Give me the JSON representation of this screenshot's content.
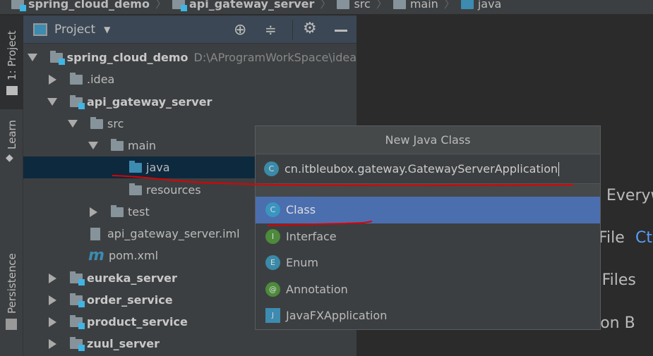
{
  "breadcrumb": [
    "spring_cloud_demo",
    "api_gateway_server",
    "src",
    "main",
    "java"
  ],
  "strip": {
    "project": "1: Project",
    "learn": "Learn",
    "persistence": "Persistence"
  },
  "panel": {
    "title": "Project"
  },
  "tree": [
    {
      "label": "spring_cloud_demo",
      "path": "D:\\AProgramWorkSpace\\idea"
    },
    {
      "label": ".idea"
    },
    {
      "label": "api_gateway_server"
    },
    {
      "label": "src"
    },
    {
      "label": "main"
    },
    {
      "label": "java"
    },
    {
      "label": "resources"
    },
    {
      "label": "test"
    },
    {
      "label": "api_gateway_server.iml"
    },
    {
      "label": "pom.xml"
    },
    {
      "label": "eureka_server"
    },
    {
      "label": "order_service"
    },
    {
      "label": "product_service"
    },
    {
      "label": "zuul_server"
    }
  ],
  "editor_hints": {
    "h1": "Everyw",
    "h2a": "File",
    "h2b": "Ct",
    "h3": "t Files",
    "h4": "ation B"
  },
  "dialog": {
    "title": "New Java Class",
    "value": "cn.itbleubox.gateway.GatewayServerApplication",
    "kinds": [
      {
        "label": "Class",
        "badge": "C",
        "color": "#3a95c0"
      },
      {
        "label": "Interface",
        "badge": "I",
        "color": "#4d8a3c"
      },
      {
        "label": "Enum",
        "badge": "E",
        "color": "#3a8aa8"
      },
      {
        "label": "Annotation",
        "badge": "@",
        "color": "#4d8a3c"
      },
      {
        "label": "JavaFXApplication",
        "badge": "J",
        "color": "#3d8bb0"
      }
    ]
  },
  "colors": {
    "selection": "#4b6eaf",
    "tree_selection": "#0d293e",
    "annotation": "#e00000"
  }
}
